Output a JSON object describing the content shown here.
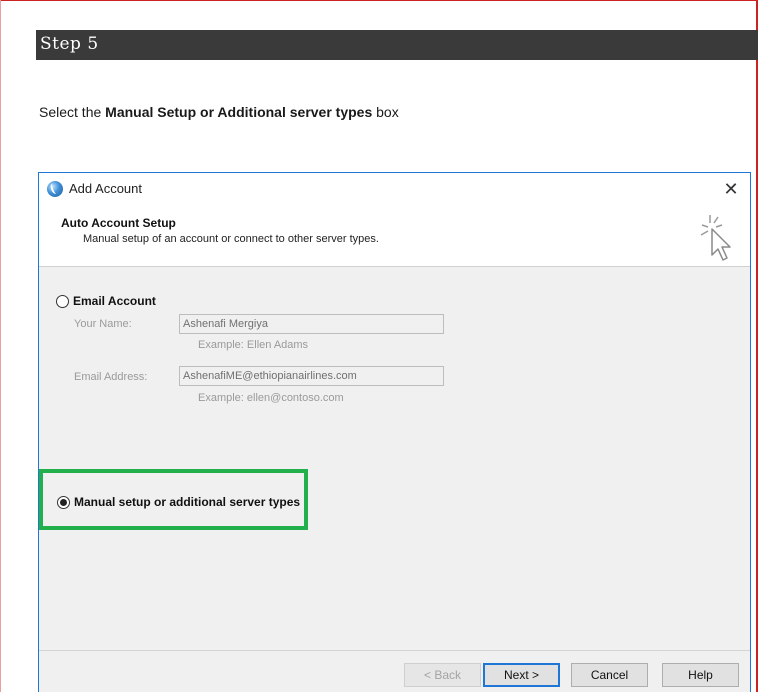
{
  "step": {
    "title": "Step 5"
  },
  "instruction": {
    "prefix": "Select the ",
    "bold": "Manual Setup or Additional server types",
    "suffix": " box"
  },
  "dialog": {
    "title": "Add Account",
    "close_icon": "close-icon",
    "app_icon": "outlook-globe-icon",
    "header": {
      "heading": "Auto Account Setup",
      "subtitle": "Manual setup of an account or connect to other server types.",
      "icon": "sparkle-cursor-icon"
    },
    "email_account": {
      "label": "Email Account",
      "selected": false,
      "fields": [
        {
          "label": "Your Name:",
          "value": "Ashenafi Mergiya",
          "example": "Example: Ellen Adams"
        },
        {
          "label": "Email Address:",
          "value": "AshenafiME@ethiopianairlines.com",
          "example": "Example: ellen@contoso.com"
        }
      ]
    },
    "manual_setup": {
      "label": "Manual setup or additional server types",
      "selected": true
    },
    "buttons": {
      "back": "< Back",
      "next": "Next >",
      "cancel": "Cancel",
      "help": "Help"
    }
  },
  "colors": {
    "highlight": "#21b04b",
    "dialog_border": "#1e76d6",
    "banner": "#3a3a3a"
  }
}
